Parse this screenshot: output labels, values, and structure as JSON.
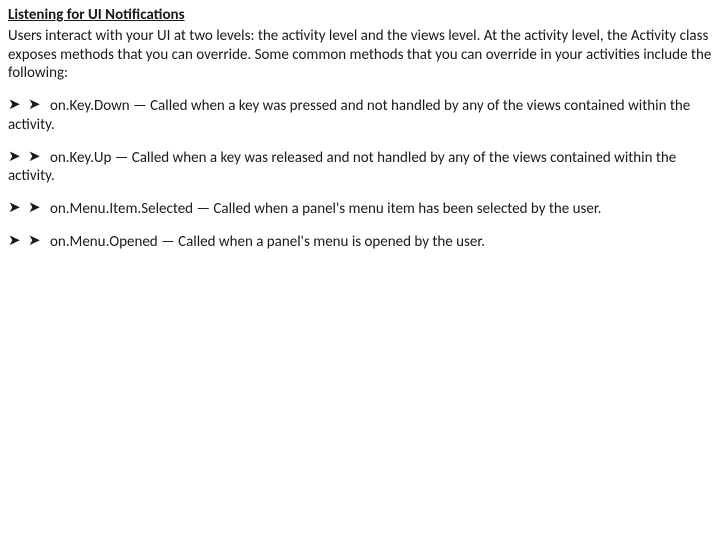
{
  "bullet_glyph": "➤ ➤",
  "heading": "Listening for UI Notifications",
  "intro": "Users interact with your UI at two levels: the activity level and the views level. At the activity level, the Activity class exposes methods that you can override. Some common methods that you can override in your activities include the following:",
  "items": [
    {
      "method": "on.Key.Down",
      "sep": " — ",
      "desc": "Called when a key was pressed and not handled by any of the views contained within the activity."
    },
    {
      "method": "on.Key.Up",
      "sep": " — ",
      "desc": "Called when a key was released and not handled by any of the views contained within the activity."
    },
    {
      "method": "on.Menu.Item.Selected",
      "sep": " — ",
      "desc": "Called when a panel's menu item has been selected by the user."
    },
    {
      "method": "on.Menu.Opened",
      "sep": " — ",
      "desc": "Called when a panel's menu is opened by the user."
    }
  ]
}
